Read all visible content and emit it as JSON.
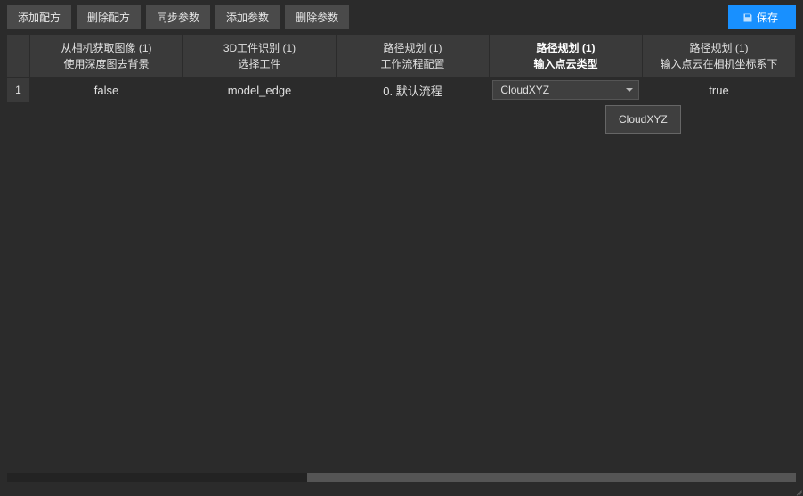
{
  "toolbar": {
    "add_recipe": "添加配方",
    "delete_recipe": "删除配方",
    "sync_params": "同步参数",
    "add_param": "添加参数",
    "delete_param": "删除参数",
    "save": "保存"
  },
  "table": {
    "columns": [
      {
        "line1": "从相机获取图像 (1)",
        "line2": "使用深度图去背景",
        "active": false
      },
      {
        "line1": "3D工件识别 (1)",
        "line2": "选择工件",
        "active": false
      },
      {
        "line1": "路径规划 (1)",
        "line2": "工作流程配置",
        "active": false
      },
      {
        "line1": "路径规划 (1)",
        "line2": "输入点云类型",
        "active": true
      },
      {
        "line1": "路径规划 (1)",
        "line2": "输入点云在相机坐标系下",
        "active": false
      }
    ],
    "rows": [
      {
        "index": "1",
        "cells": [
          "false",
          "model_edge",
          "0. 默认流程",
          "CloudXYZ",
          "true"
        ]
      }
    ]
  },
  "dropdown": {
    "selected": "CloudXYZ",
    "options": [
      "CloudXYZ"
    ]
  }
}
